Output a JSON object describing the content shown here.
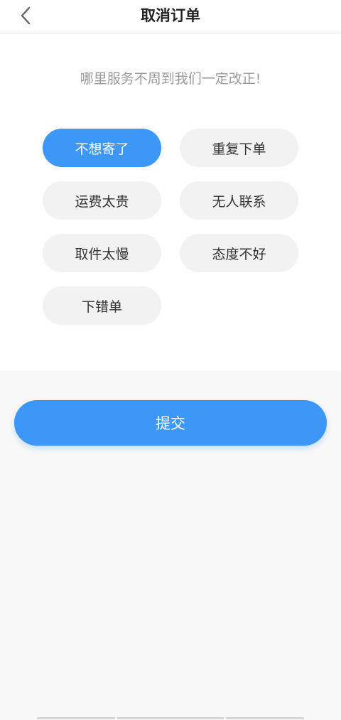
{
  "header": {
    "title": "取消订单",
    "back_icon": "chevron-left-icon"
  },
  "prompt": "哪里服务不周到我们一定改正!",
  "reasons": [
    {
      "label": "不想寄了",
      "selected": true
    },
    {
      "label": "重复下单",
      "selected": false
    },
    {
      "label": "运费太贵",
      "selected": false
    },
    {
      "label": "无人联系",
      "selected": false
    },
    {
      "label": "取件太慢",
      "selected": false
    },
    {
      "label": "态度不好",
      "selected": false
    },
    {
      "label": "下错单",
      "selected": false
    }
  ],
  "submit_label": "提交",
  "colors": {
    "accent": "#3d97f7",
    "chip_bg": "#f2f2f2",
    "prompt_text": "#9a9a9a"
  }
}
